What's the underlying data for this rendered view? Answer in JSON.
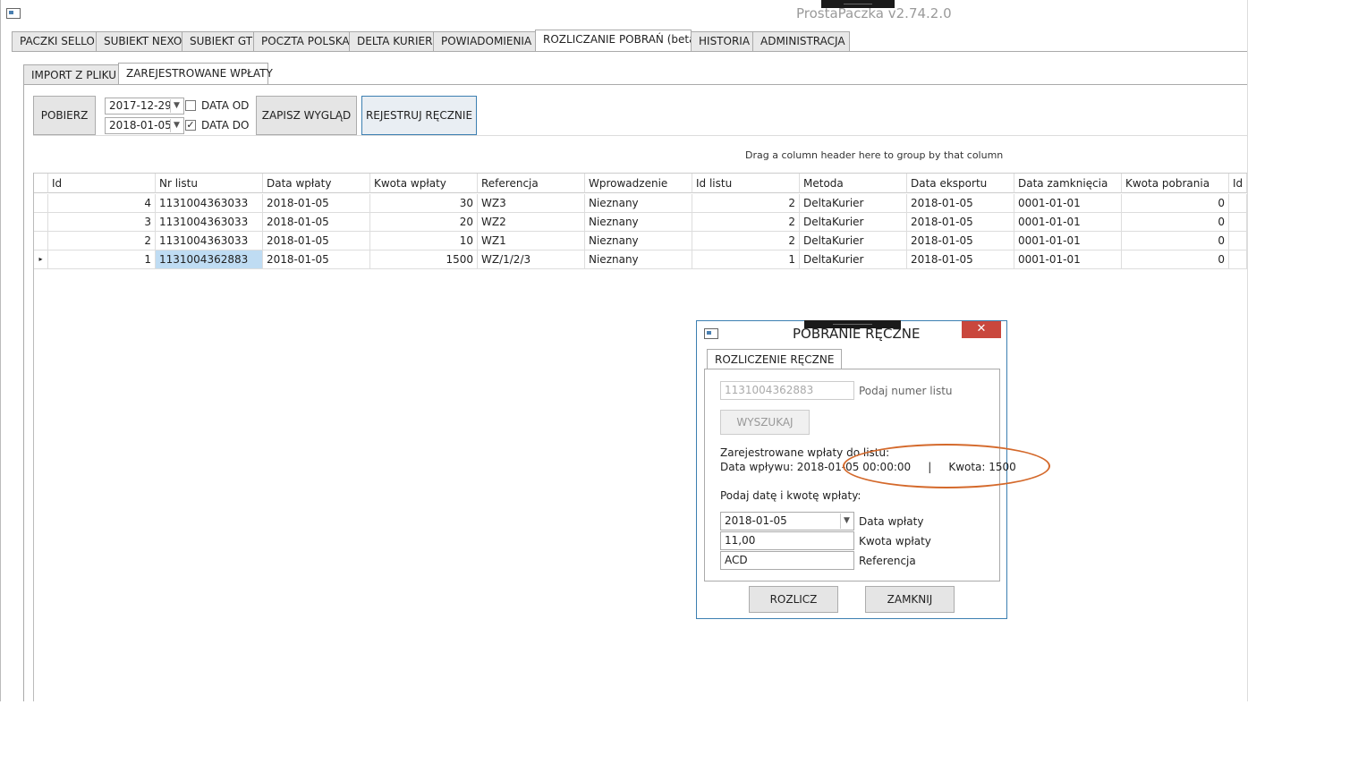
{
  "window": {
    "title": "ProstaPaczka v2.74.2.0"
  },
  "tabs": [
    {
      "label": "PACZKI SELLO"
    },
    {
      "label": "SUBIEKT NEXO"
    },
    {
      "label": "SUBIEKT GT"
    },
    {
      "label": "POCZTA POLSKA"
    },
    {
      "label": "DELTA KURIER"
    },
    {
      "label": "POWIADOMIENIA"
    },
    {
      "label": "ROZLICZANIE POBRAŃ (beta)"
    },
    {
      "label": "HISTORIA"
    },
    {
      "label": "ADMINISTRACJA"
    }
  ],
  "subtabs": [
    {
      "label": "IMPORT Z PLIKU"
    },
    {
      "label": "ZAREJESTROWANE WPŁATY"
    }
  ],
  "toolbar": {
    "fetch_label": "POBIERZ",
    "date_from": "2017-12-29",
    "date_to": "2018-01-05",
    "date_from_label": "DATA OD",
    "date_to_label": "DATA DO",
    "date_from_checked": false,
    "date_to_checked": true,
    "save_layout_label": "ZAPISZ WYGLĄD",
    "register_manual_label": "REJESTRUJ RĘCZNIE"
  },
  "grid": {
    "group_hint": "Drag a column header here to group by that column",
    "columns": [
      "Id",
      "Nr listu",
      "Data wpłaty",
      "Kwota wpłaty",
      "Referencja",
      "Wprowadzenie",
      "Id listu",
      "Metoda",
      "Data eksportu",
      "Data zamknięcia",
      "Kwota pobrania",
      "Id w"
    ],
    "rows": [
      [
        "4",
        "1131004363033",
        "2018-01-05",
        "30",
        "WZ3",
        "Nieznany",
        "2",
        "DeltaKurier",
        "2018-01-05",
        "0001-01-01",
        "0"
      ],
      [
        "3",
        "1131004363033",
        "2018-01-05",
        "20",
        "WZ2",
        "Nieznany",
        "2",
        "DeltaKurier",
        "2018-01-05",
        "0001-01-01",
        "0"
      ],
      [
        "2",
        "1131004363033",
        "2018-01-05",
        "10",
        "WZ1",
        "Nieznany",
        "2",
        "DeltaKurier",
        "2018-01-05",
        "0001-01-01",
        "0"
      ],
      [
        "1",
        "1131004362883",
        "2018-01-05",
        "1500",
        "WZ/1/2/3",
        "Nieznany",
        "1",
        "DeltaKurier",
        "2018-01-05",
        "0001-01-01",
        "0"
      ]
    ],
    "current_row_marker": "▸"
  },
  "dialog": {
    "title": "POBRANIE RĘCZNE",
    "close_glyph": "✕",
    "tab_label": "ROZLICZENIE RĘCZNE",
    "list_number": "1131004362883",
    "list_number_label": "Podaj numer listu",
    "search_label": "WYSZUKAJ",
    "registered_heading": "Zarejestrowane wpłaty do listu:",
    "registered_line": "Data wpływu: 2018-01-05 00:00:00     |     Kwota: 1500",
    "enter_heading": "Podaj datę i kwotę wpłaty:",
    "payment_date": "2018-01-05",
    "payment_date_label": "Data wpłaty",
    "payment_amount": "11,00",
    "payment_amount_label": "Kwota wpłaty",
    "reference": "ACD",
    "reference_label": "Referencja",
    "settle_label": "ROZLICZ",
    "close_label": "ZAMKNIJ"
  },
  "colors": {
    "accent": "#3c7fb1",
    "close_red": "#c9473d",
    "annotation": "#d4692b",
    "selection": "#bfdcf3"
  }
}
